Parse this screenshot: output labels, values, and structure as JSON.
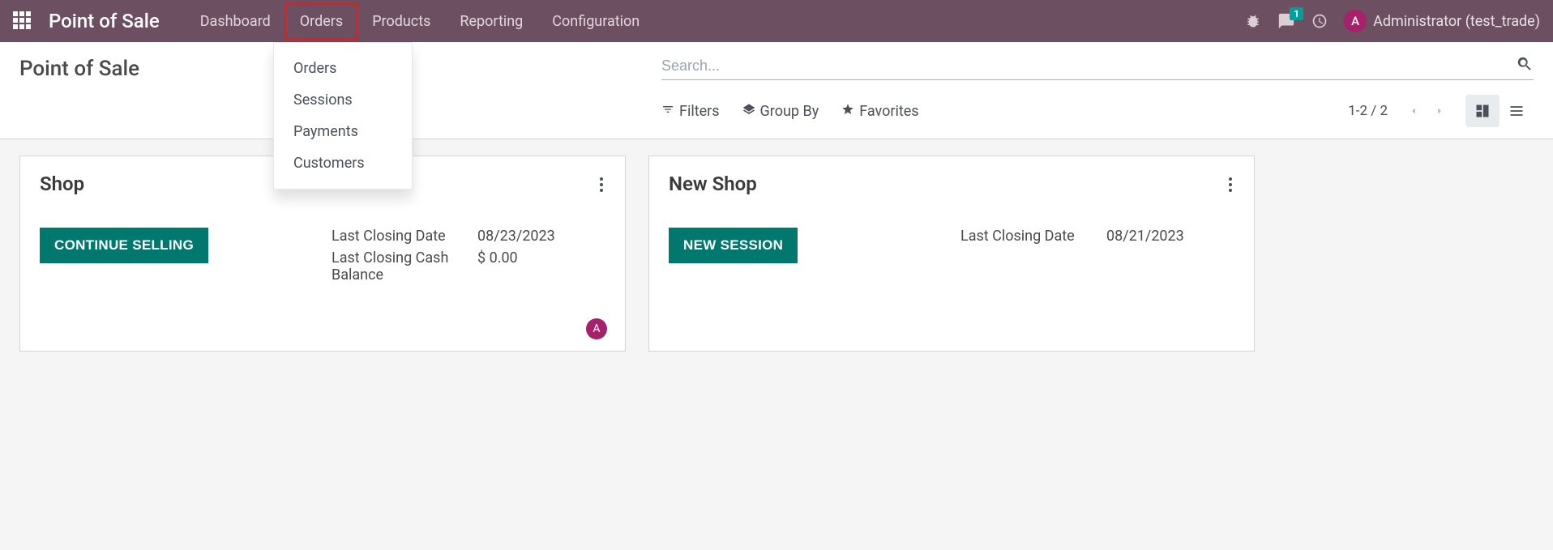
{
  "navbar": {
    "brand": "Point of Sale",
    "items": [
      "Dashboard",
      "Orders",
      "Products",
      "Reporting",
      "Configuration"
    ],
    "active_index": 1,
    "messages_badge": "1",
    "user_initial": "A",
    "user_label": "Administrator (test_trade)"
  },
  "dropdown": {
    "items": [
      "Orders",
      "Sessions",
      "Payments",
      "Customers"
    ]
  },
  "control_panel": {
    "title": "Point of Sale",
    "search_placeholder": "Search...",
    "filters_label": "Filters",
    "groupby_label": "Group By",
    "favorites_label": "Favorites",
    "pager": "1-2 / 2"
  },
  "cards": [
    {
      "title": "Shop",
      "action_label": "CONTINUE SELLING",
      "fields": [
        {
          "label": "Last Closing Date",
          "value": "08/23/2023"
        },
        {
          "label": "Last Closing Cash Balance",
          "value": "$ 0.00"
        }
      ],
      "avatar_initial": "A",
      "show_avatar": true
    },
    {
      "title": "New Shop",
      "action_label": "NEW SESSION",
      "fields": [
        {
          "label": "Last Closing Date",
          "value": "08/21/2023"
        }
      ],
      "show_avatar": false
    }
  ]
}
